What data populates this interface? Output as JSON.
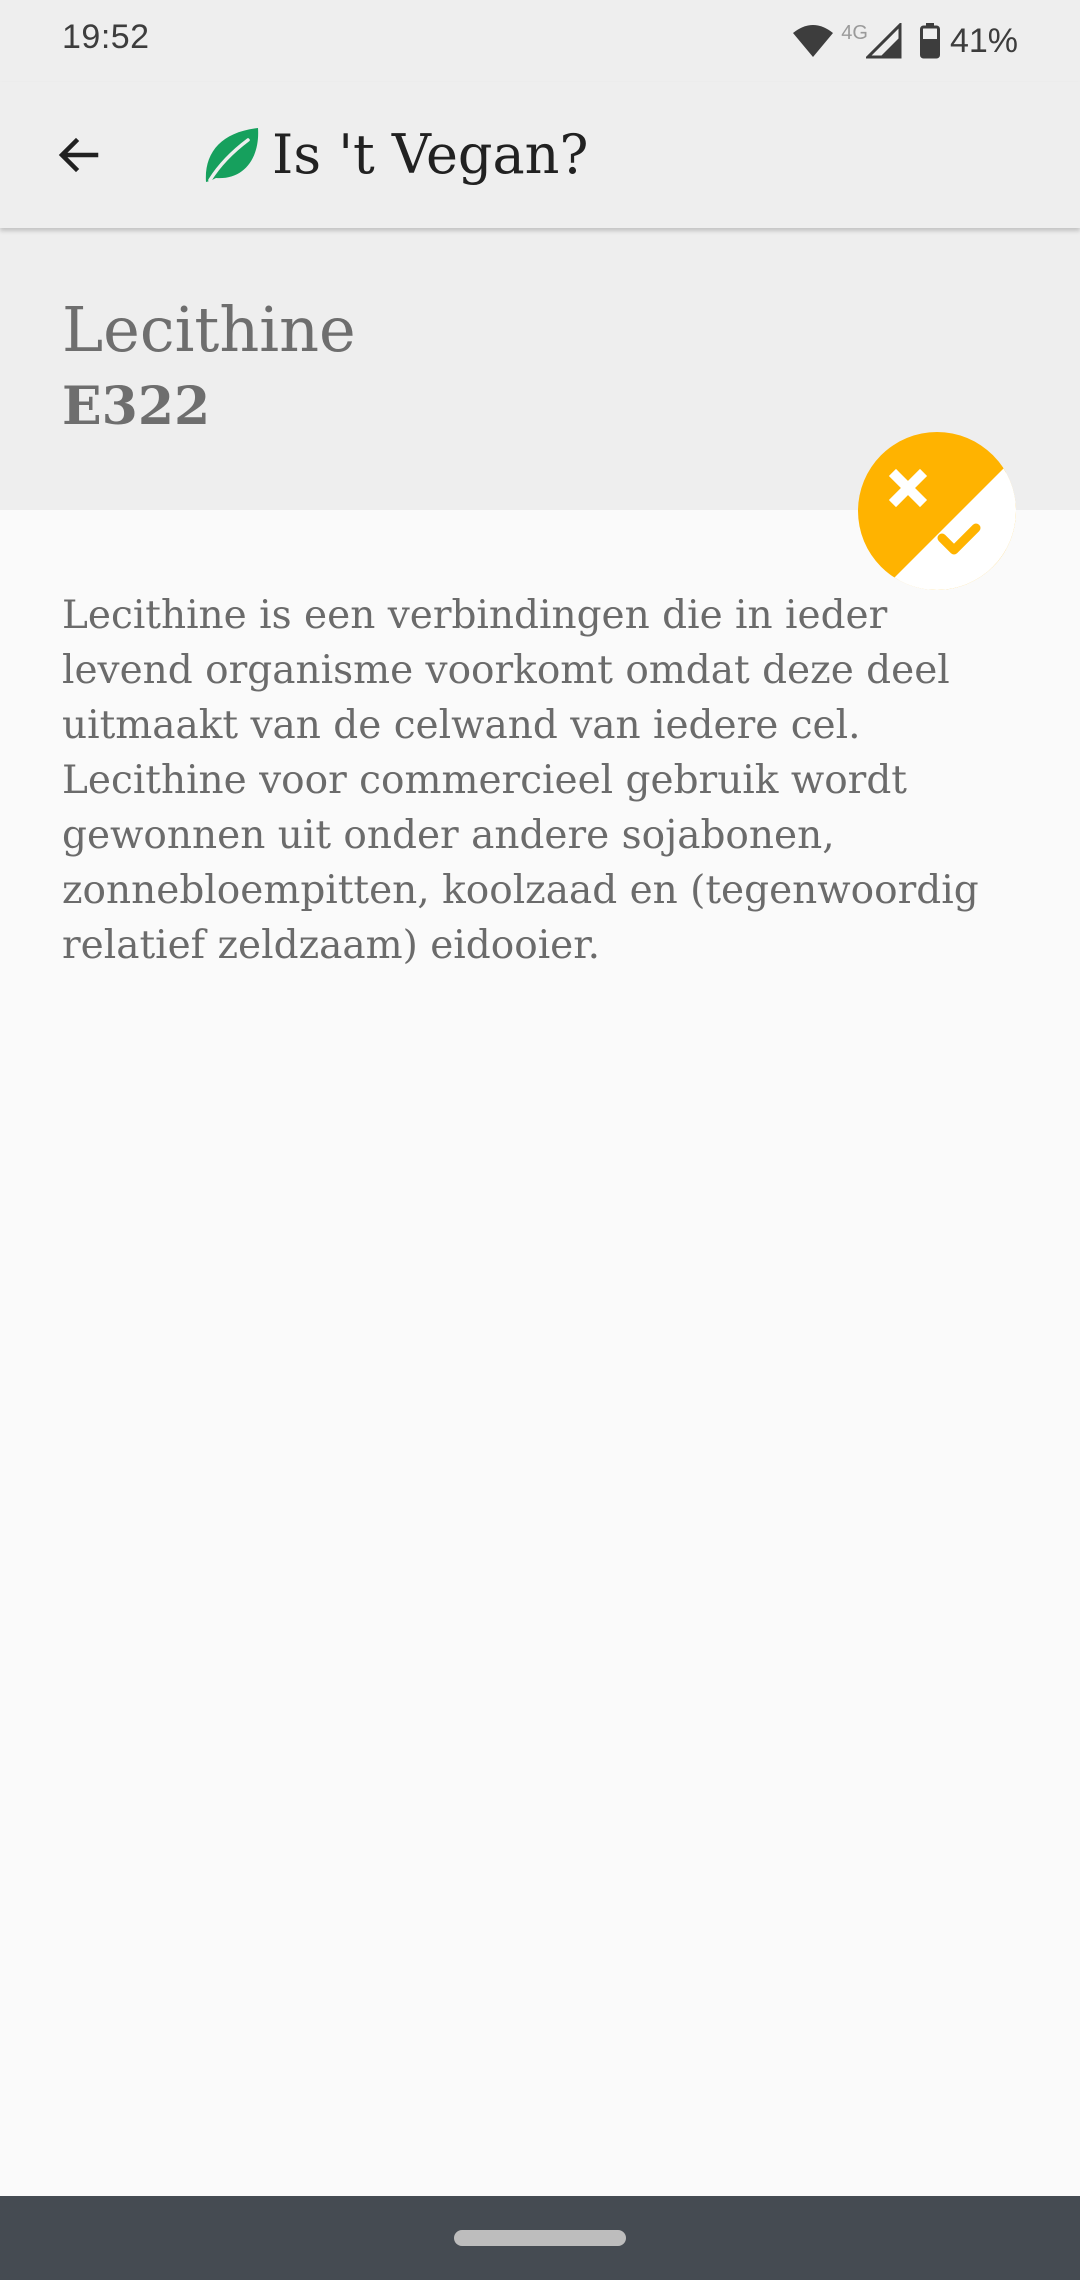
{
  "status_bar": {
    "time": "19:52",
    "network": "4G",
    "battery": "41%",
    "icons": [
      "wifi-icon",
      "cell-signal-icon",
      "battery-icon"
    ]
  },
  "app_bar": {
    "title": "Is 't Vegan?",
    "back_icon": "arrow-left-icon",
    "logo_icon": "leaf-icon"
  },
  "ingredient": {
    "name": "Lecithine",
    "code": "E322",
    "status_icon": "maybe-vegan-icon",
    "description": "Lecithine is een verbindingen die in ieder levend organisme voorkomt omdat deze deel uitmaakt van de celwand van iedere cel. Lecithine voor commercieel gebruik wordt gewonnen uit onder andere sojabonen, zonnebloempitten, koolzaad en (tegenwoordig relatief zeldzaam) eidooier."
  },
  "colors": {
    "accent_green": "#16a05d",
    "status_orange": "#ffb300",
    "app_bar_bg": "#eeeeee",
    "nav_bar_bg": "#454b52"
  }
}
